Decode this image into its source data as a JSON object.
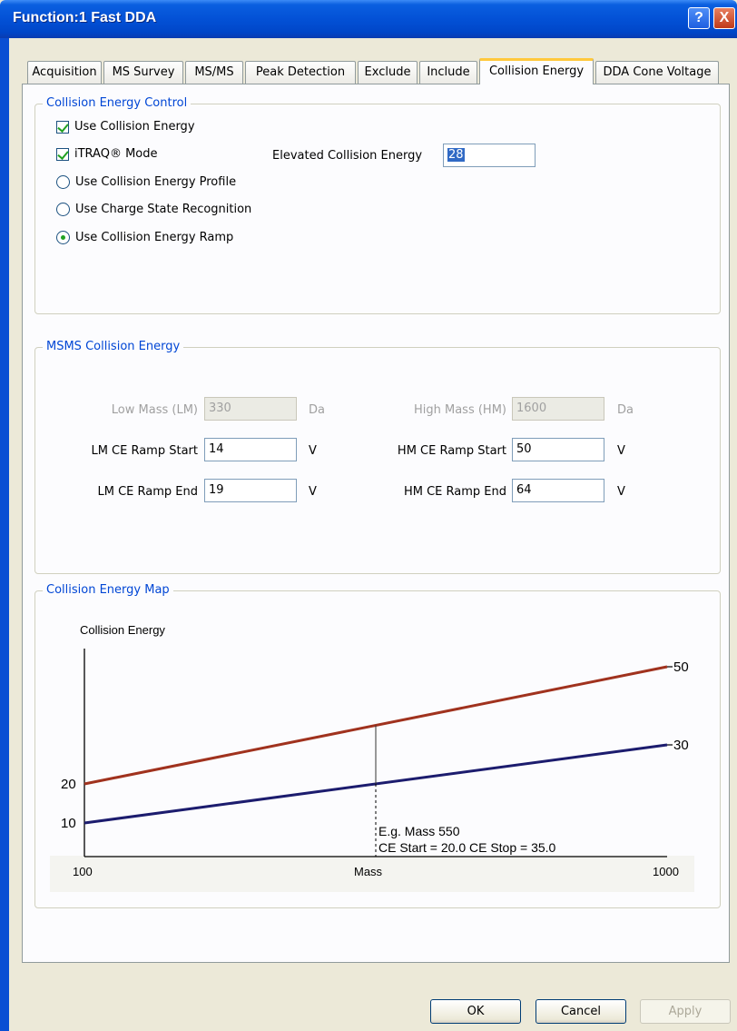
{
  "window": {
    "title": "Function:1 Fast DDA",
    "help_label": "?",
    "close_label": "X"
  },
  "tabs": [
    {
      "label": "Acquisition"
    },
    {
      "label": "MS Survey"
    },
    {
      "label": "MS/MS"
    },
    {
      "label": "Peak Detection"
    },
    {
      "label": "Exclude"
    },
    {
      "label": "Include"
    },
    {
      "label": "Collision Energy",
      "active": true
    },
    {
      "label": "DDA Cone Voltage"
    }
  ],
  "collision_energy_control": {
    "title": "Collision Energy Control",
    "use_collision_energy": {
      "label": "Use Collision Energy",
      "checked": true
    },
    "itraq_mode": {
      "label": "iTRAQ® Mode",
      "checked": true
    },
    "elevated_label": "Elevated Collision Energy",
    "elevated_value": "28",
    "options": [
      {
        "label": "Use Collision Energy Profile",
        "selected": false
      },
      {
        "label": "Use Charge State Recognition",
        "selected": false
      },
      {
        "label": "Use Collision Energy Ramp",
        "selected": true
      }
    ]
  },
  "msms": {
    "title": "MSMS Collision Energy",
    "low_mass_label": "Low Mass (LM)",
    "low_mass_value": "330",
    "low_mass_unit": "Da",
    "high_mass_label": "High Mass (HM)",
    "high_mass_value": "1600",
    "high_mass_unit": "Da",
    "lm_start_label": "LM CE Ramp Start",
    "lm_start_value": "14",
    "lm_end_label": "LM CE Ramp End",
    "lm_end_value": "19",
    "hm_start_label": "HM CE Ramp Start",
    "hm_start_value": "50",
    "hm_end_label": "HM CE Ramp End",
    "hm_end_value": "64",
    "volt_unit": "V"
  },
  "map": {
    "title": "Collision Energy Map"
  },
  "chart_data": {
    "type": "line",
    "ylabel": "Collision Energy",
    "xlabel": "Mass",
    "x_ticks": [
      "100",
      "1000"
    ],
    "y_ticks_left": [
      "20",
      "10"
    ],
    "series": [
      {
        "color": "#a0321e",
        "x": [
          100,
          1000
        ],
        "y": [
          20,
          50
        ],
        "end_label": "50"
      },
      {
        "color": "#1c1c6e",
        "x": [
          100,
          1000
        ],
        "y": [
          10,
          30
        ],
        "end_label": "30"
      }
    ],
    "annotation": {
      "x": 550,
      "line1": "E.g. Mass 550",
      "line2": "CE Start = 20.0  CE Stop = 35.0"
    }
  },
  "buttons": {
    "ok": "OK",
    "cancel": "Cancel",
    "apply": "Apply"
  }
}
